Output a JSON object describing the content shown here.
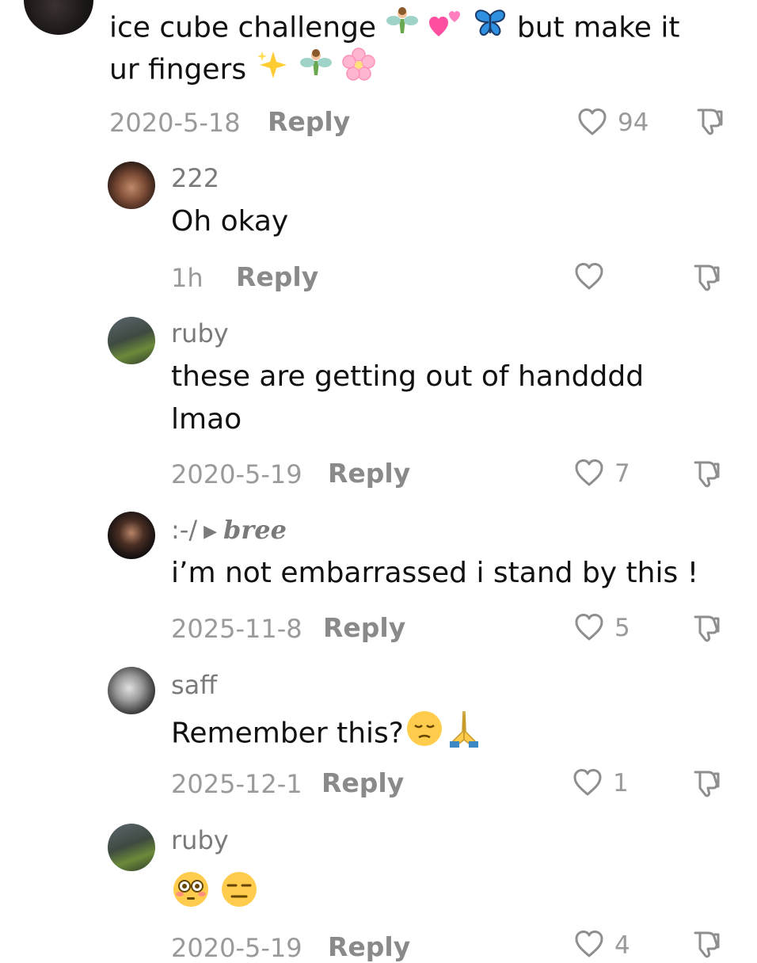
{
  "comments": [
    {
      "text_line1_a": "ice cube challenge",
      "text_line1_b": "but make it",
      "text_line2": "ur fingers",
      "date": "2020-5-18",
      "reply": "Reply",
      "likes": "94",
      "emojis_line1": [
        "fairy",
        "two-hearts",
        "butterfly"
      ],
      "emojis_line2": [
        "sparkles",
        "fairy",
        "cherry-blossom"
      ]
    },
    {
      "username": "222",
      "text": "Oh okay",
      "date": "1h",
      "reply": "Reply",
      "likes": ""
    },
    {
      "username": "ruby",
      "text_line1": "these are getting out of handddd",
      "text_line2": "lmao",
      "date": "2020-5-19",
      "reply": "Reply",
      "likes": "7"
    },
    {
      "username": ":-/",
      "reply_to": "bree",
      "text": "i’m not embarrassed i stand by this !",
      "date": "2025-11-8",
      "reply": "Reply",
      "likes": "5"
    },
    {
      "username": "saff",
      "text": "Remember this?",
      "emojis": [
        "pensive-face",
        "folded-hands"
      ],
      "date": "2025-12-1",
      "reply": "Reply",
      "likes": "1"
    },
    {
      "username": "ruby",
      "emojis": [
        "flushed-face",
        "expressionless-face"
      ],
      "date": "2020-5-19",
      "reply": "Reply",
      "likes": "4"
    }
  ]
}
